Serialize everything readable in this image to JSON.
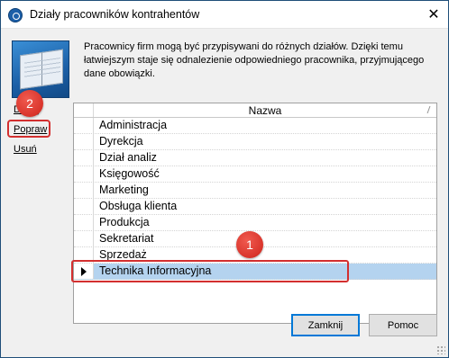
{
  "window": {
    "title": "Działy pracowników kontrahentów",
    "close_glyph": "✕"
  },
  "description": "Pracownicy firm mogą być przypisywani do różnych działów. Dzięki temu łatwiejszym staje się odnalezienie odpowiedniego pracownika, przyjmującego dane obowiązki.",
  "side_links": {
    "add": "Dodaj",
    "edit": "Popraw",
    "delete": "Usuń"
  },
  "grid": {
    "column_header": "Nazwa",
    "rows": [
      "Administracja",
      "Dyrekcja",
      "Dział analiz",
      "Księgowość",
      "Marketing",
      "Obsługa klienta",
      "Produkcja",
      "Sekretariat",
      "Sprzedaż",
      "Technika Informacyjna"
    ],
    "selected_row": "Technika Informacyjna"
  },
  "annotations": {
    "badge_1": "1",
    "badge_2": "2",
    "color": "#d32f2f"
  },
  "buttons": {
    "close": "Zamknij",
    "help": "Pomoc"
  },
  "colors": {
    "selection": "#b4d3ef",
    "accent": "#0078d7"
  }
}
